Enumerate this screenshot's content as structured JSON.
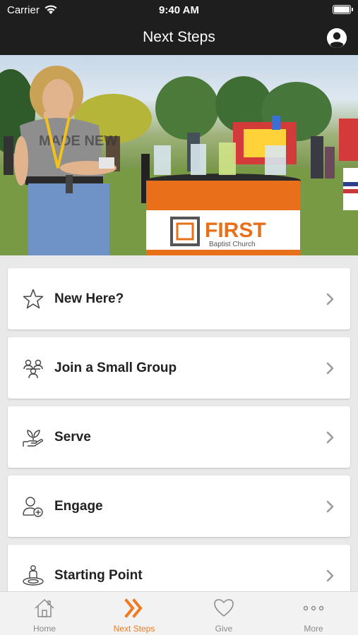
{
  "status_bar": {
    "carrier": "Carrier",
    "time": "9:40 AM"
  },
  "nav_bar": {
    "title": "Next Steps"
  },
  "hero": {
    "banner_brand": "FIRST",
    "banner_sub": "Baptist Church",
    "shirt_text": "MADE NEW"
  },
  "menu": {
    "items": [
      {
        "label": "New Here?",
        "icon": "star-icon"
      },
      {
        "label": "Join a Small Group",
        "icon": "group-icon"
      },
      {
        "label": "Serve",
        "icon": "serve-hand-icon"
      },
      {
        "label": "Engage",
        "icon": "add-user-icon"
      },
      {
        "label": "Starting Point",
        "icon": "starting-point-icon"
      }
    ]
  },
  "tabs": [
    {
      "label": "Home",
      "icon": "home-icon"
    },
    {
      "label": "Next Steps",
      "icon": "double-chevron-icon",
      "active": true
    },
    {
      "label": "Give",
      "icon": "heart-icon"
    },
    {
      "label": "More",
      "icon": "more-dots-icon"
    }
  ],
  "colors": {
    "accent": "#f07a20",
    "bar": "#1e1e1e",
    "background": "#e9e9e9"
  }
}
